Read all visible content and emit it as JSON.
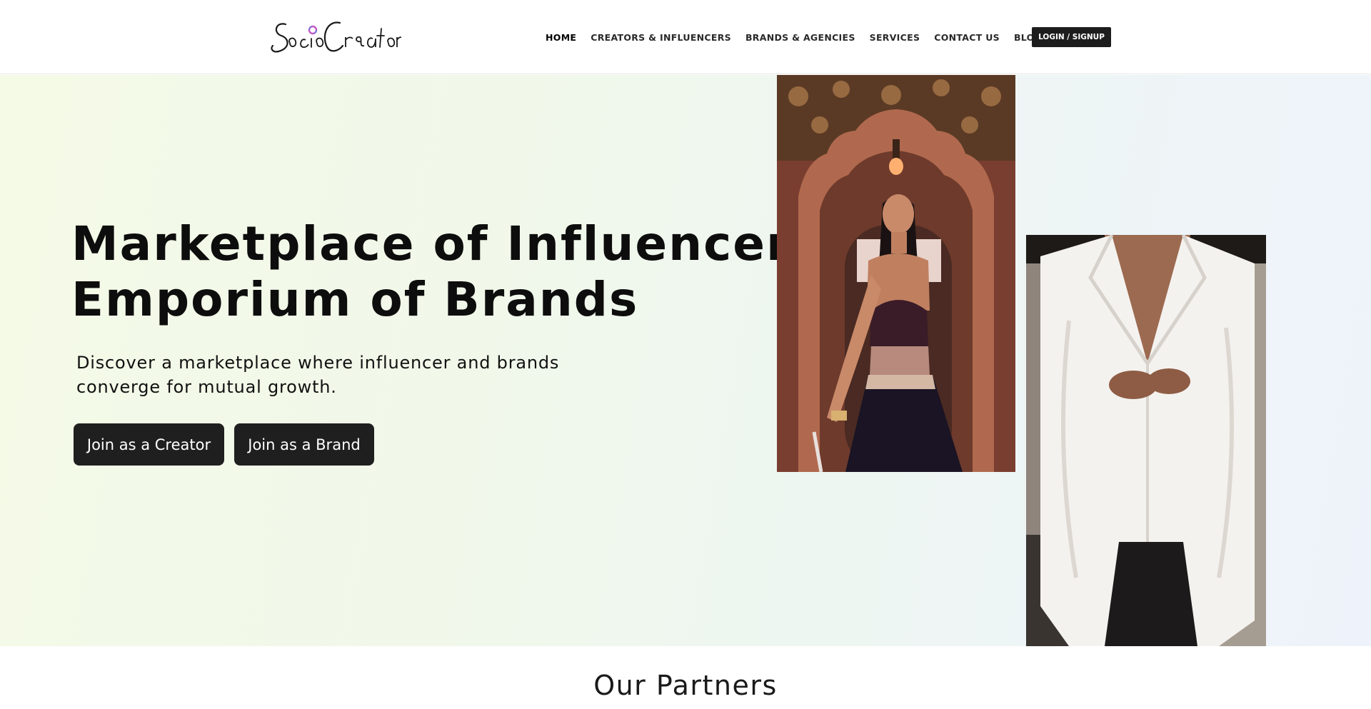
{
  "brand": {
    "logo_text": "SocioCreator"
  },
  "nav": {
    "items": [
      {
        "label": "HOME"
      },
      {
        "label": "CREATORS & INFLUENCERS"
      },
      {
        "label": "BRANDS & AGENCIES"
      },
      {
        "label": "SERVICES"
      },
      {
        "label": "CONTACT US"
      },
      {
        "label": "BLOGS"
      }
    ],
    "login_label": "LOGIN / SIGNUP"
  },
  "hero": {
    "title_line1": "Marketplace of Influencer,",
    "title_line2": "Emporium of Brands",
    "subtitle": "Discover a marketplace where influencer and brands converge for mutual growth.",
    "cta_creator": "Join as a Creator",
    "cta_brand": "Join as a Brand"
  },
  "partners": {
    "title": "Our Partners"
  },
  "colors": {
    "button_bg": "#1f1f1f",
    "hero_gradient_start": "#f4fae6",
    "hero_gradient_end": "#eef3fb"
  }
}
